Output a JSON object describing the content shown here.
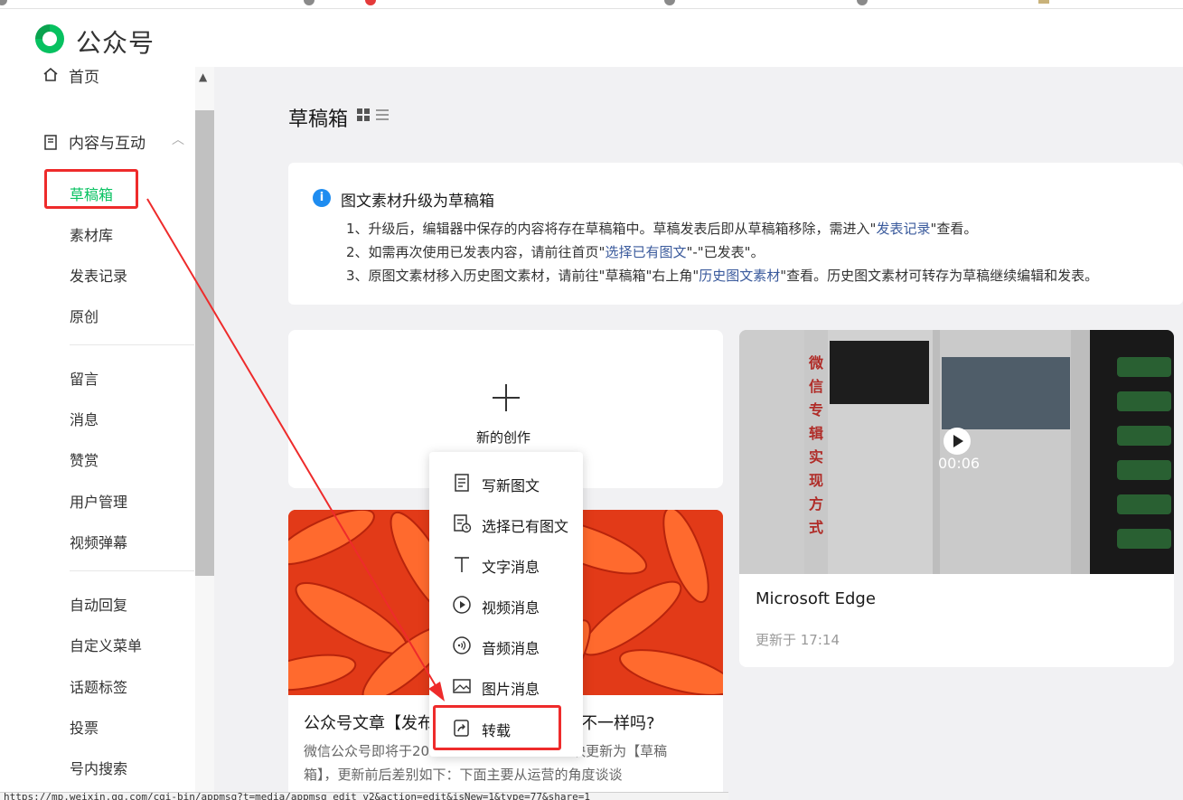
{
  "brand": {
    "name": "公众号",
    "logo_icon": "wechat-official-logo-icon",
    "accent": "#07c160"
  },
  "sidebar": {
    "home_label": "首页",
    "group_label": "内容与互动",
    "items_a": [
      "草稿箱",
      "素材库",
      "发表记录",
      "原创"
    ],
    "items_b": [
      "留言",
      "消息",
      "赞赏",
      "用户管理",
      "视频弹幕"
    ],
    "items_c": [
      "自动回复",
      "自定义菜单",
      "话题标签",
      "投票",
      "号内搜索"
    ],
    "active_item": "草稿箱"
  },
  "page": {
    "title": "草稿箱",
    "view_icons": [
      "grid-view-icon",
      "list-view-icon"
    ]
  },
  "notice": {
    "title": "图文素材升级为草稿箱",
    "line1_pre": "1、升级后，编辑器中保存的内容将存在草稿箱中。草稿发表后即从草稿箱移除，需进入\"",
    "line1_link": "发表记录",
    "line1_post": "\"查看。",
    "line2_pre": "2、如需再次使用已发表内容，请前往首页\"",
    "line2_link": "选择已有图文",
    "line2_post": "\"-\"已发表\"。",
    "line3_pre": "3、原图文素材移入历史图文素材，请前往\"草稿箱\"右上角\"",
    "line3_link": "历史图文素材",
    "line3_post": "\"查看。历史图文素材可转存为草稿继续编辑和发表。"
  },
  "new_card": {
    "label": "新的创作"
  },
  "menu": {
    "items": [
      {
        "label": "写新图文",
        "icon": "new-article-icon"
      },
      {
        "label": "选择已有图文",
        "icon": "existing-article-icon"
      },
      {
        "label": "文字消息",
        "icon": "text-message-icon"
      },
      {
        "label": "视频消息",
        "icon": "video-message-icon"
      },
      {
        "label": "音频消息",
        "icon": "audio-message-icon"
      },
      {
        "label": "图片消息",
        "icon": "image-message-icon"
      },
      {
        "label": "转载",
        "icon": "repost-icon"
      }
    ]
  },
  "article_card": {
    "title_left": "公众号文章【发布",
    "title_right": "不一样吗?",
    "desc1_left": "微信公众号即将于20",
    "desc1_right": "块更新为【草稿",
    "desc2": "箱】，更新前后差别如下：下面主要从运营的角度谈谈"
  },
  "video_card": {
    "duration": "00:06",
    "title": "Microsoft Edge",
    "updated": "更新于 17:14"
  },
  "browser": {
    "status_url": "https://mp.weixin.qq.com/cgi-bin/appmsg?t=media/appmsg_edit_v2&action=edit&isNew=1&type=77&share=1"
  },
  "annotation_color": "#ee2b2b"
}
